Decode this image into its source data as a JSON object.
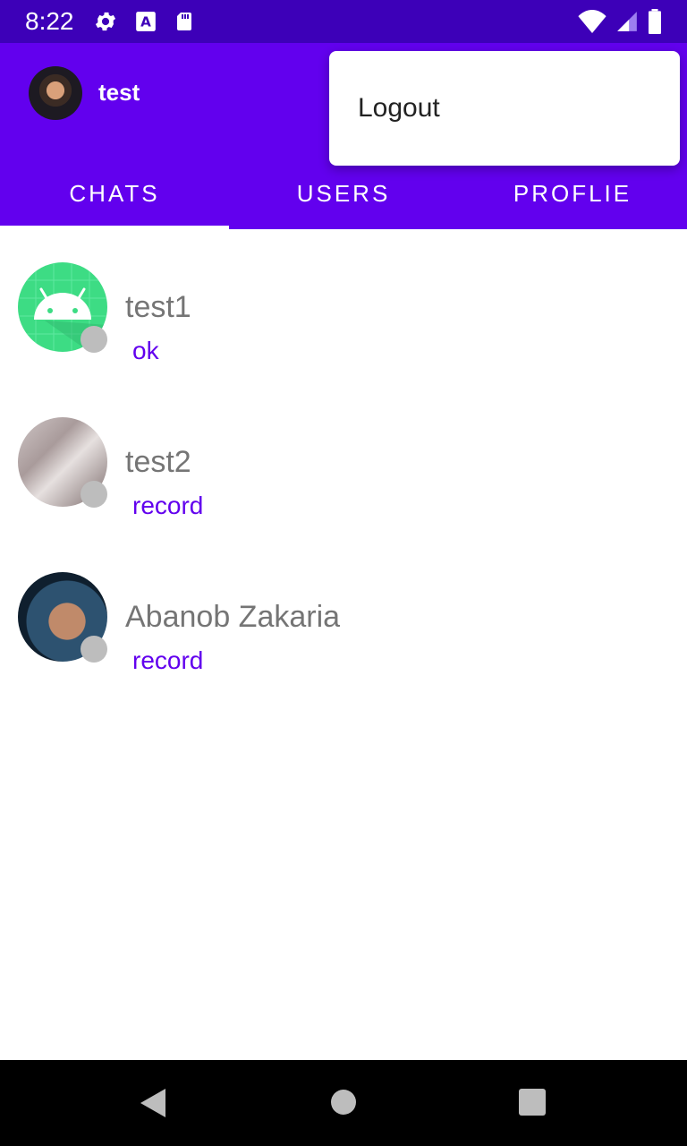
{
  "status_bar": {
    "time": "8:22",
    "icons_left": [
      "settings-icon",
      "accessibility-a-icon",
      "sd-card-icon"
    ],
    "icons_right": [
      "wifi-icon",
      "cell-signal-icon",
      "battery-icon"
    ]
  },
  "toolbar": {
    "title": "test"
  },
  "tabs": [
    {
      "label": "CHATS",
      "selected": true
    },
    {
      "label": "USERS",
      "selected": false
    },
    {
      "label": "PROFLIE",
      "selected": false
    }
  ],
  "menu": {
    "items": [
      {
        "label": "Logout"
      }
    ]
  },
  "chats": [
    {
      "name": "test1",
      "last_message": "ok",
      "online": false
    },
    {
      "name": "test2",
      "last_message": "record",
      "online": false
    },
    {
      "name": "Abanob Zakaria",
      "last_message": "record",
      "online": false
    }
  ],
  "colors": {
    "primary": "#6200ee",
    "status_bar": "#3d00b8",
    "accent_text": "#6200ee",
    "offline_dot": "#bdbdbd"
  }
}
